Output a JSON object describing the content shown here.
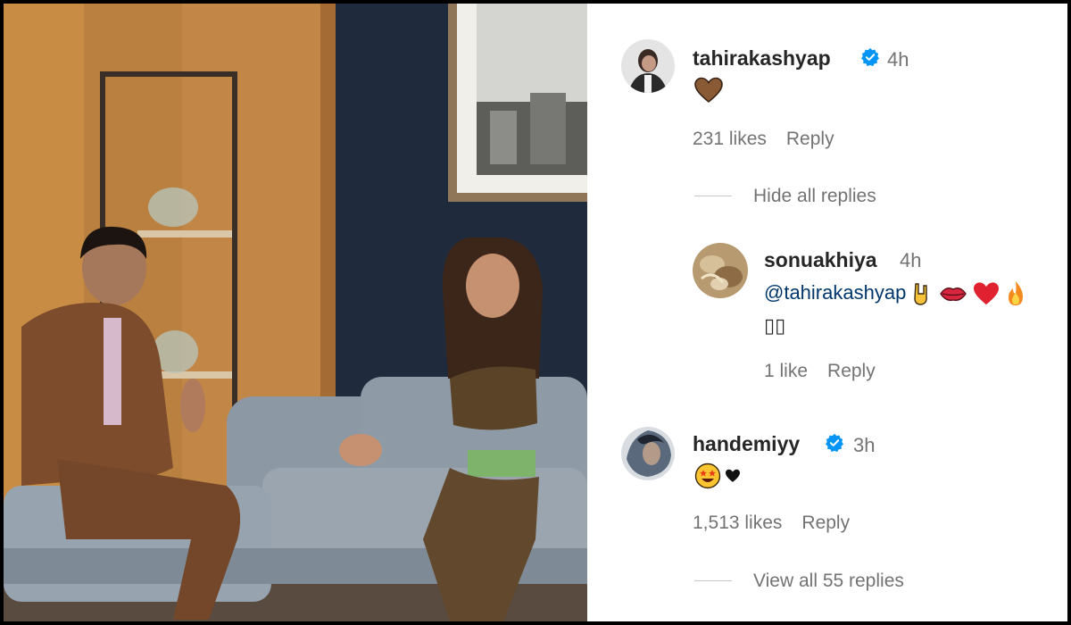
{
  "comments": [
    {
      "username": "tahirakashyap",
      "verified": true,
      "time": "4h",
      "text": "",
      "emoji": [
        "brown-heart"
      ],
      "likes": "231 likes",
      "reply_label": "Reply",
      "replies_toggle": "Hide all replies"
    },
    {
      "username": "sonuakhiya",
      "verified": false,
      "time": "4h",
      "mention": "@tahirakashyap",
      "text": "",
      "emoji": [
        "rock-hand",
        "lips",
        "red-heart",
        "fire"
      ],
      "second_line": "▯▯",
      "likes": "1 like",
      "reply_label": "Reply",
      "is_reply": true
    },
    {
      "username": "handemiyy",
      "verified": true,
      "time": "3h",
      "text": "",
      "emoji": [
        "star-struck-face",
        "black-heart"
      ],
      "likes": "1,513 likes",
      "reply_label": "Reply",
      "replies_toggle": "View all 55 replies"
    }
  ],
  "colors": {
    "verified_badge": "#0095f6",
    "mention": "#00376b",
    "muted_text": "#737373"
  }
}
